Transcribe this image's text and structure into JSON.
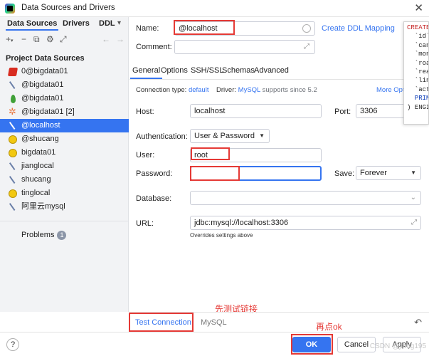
{
  "window": {
    "title": "Data Sources and Drivers"
  },
  "left": {
    "tabs": [
      "Data Sources",
      "Drivers",
      "DDL"
    ],
    "section_header": "Project Data Sources",
    "items": [
      {
        "label": "0@bigdata01",
        "icon": "redis-icon"
      },
      {
        "label": "@bigdata01",
        "icon": "mysql-icon"
      },
      {
        "label": "@bigdata01",
        "icon": "mongodb-icon"
      },
      {
        "label": "@bigdata01 [2]",
        "icon": "spark-icon"
      },
      {
        "label": "@localhost",
        "icon": "mysql-icon"
      },
      {
        "label": "@shucang",
        "icon": "hive-icon"
      },
      {
        "label": "bigdata01",
        "icon": "hive-icon"
      },
      {
        "label": "jianglocal",
        "icon": "mysql-icon"
      },
      {
        "label": "shucang",
        "icon": "mysql-icon"
      },
      {
        "label": "tinglocal",
        "icon": "hive-icon"
      },
      {
        "label": "阿里云mysql",
        "icon": "mysql-icon"
      }
    ],
    "problems_label": "Problems",
    "problems_count": "1"
  },
  "form": {
    "name_label": "Name:",
    "name_value": "@localhost",
    "create_ddl_link": "Create DDL Mapping",
    "comment_label": "Comment:",
    "tabs": [
      "General",
      "Options",
      "SSH/SSL",
      "Schemas",
      "Advanced"
    ],
    "conn_type_label": "Connection type:",
    "conn_type_value": "default",
    "driver_label": "Driver:",
    "driver_value": "MySQL",
    "driver_note": "supports since 5.2",
    "more_options": "More Opti",
    "host_label": "Host:",
    "host_value": "localhost",
    "port_label": "Port:",
    "port_value": "3306",
    "auth_label": "Authentication:",
    "auth_value": "User & Password",
    "user_label": "User:",
    "user_value": "root",
    "password_label": "Password:",
    "save_label": "Save:",
    "save_value": "Forever",
    "database_label": "Database:",
    "url_label": "URL:",
    "url_value": "jdbc:mysql://localhost:3306",
    "url_hint": "Overrides settings above"
  },
  "sql_popup": {
    "lines": [
      "CREATE",
      "  `id`",
      "  `can",
      "  `mon",
      "  `roa",
      "  `rea",
      "  `lin",
      "  `act",
      "  PRIM",
      ") ENGI"
    ]
  },
  "bottom": {
    "test_connection": "Test Connection",
    "mysql_tab": "MySQL"
  },
  "annotations": {
    "test_first": "先测试链接",
    "then_ok": "再点ok"
  },
  "footer": {
    "help": "?",
    "ok": "OK",
    "cancel": "Cancel",
    "apply": "Apply",
    "watermark": "CSDN @jiang195"
  },
  "colors": {
    "accent": "#3574f0",
    "annotation": "#e53935"
  }
}
